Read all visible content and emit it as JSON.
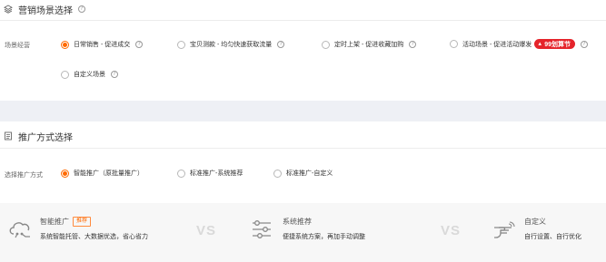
{
  "marketing_scene": {
    "title": "营销场景选择",
    "row_label": "场景经营",
    "options": [
      {
        "label": "日常销售 - 促进成交",
        "checked": true
      },
      {
        "label": "宝贝测款 - 均匀快速获取流量",
        "checked": false
      },
      {
        "label": "定时上架 - 促进收藏加购",
        "checked": false
      },
      {
        "label": "活动场景 - 促进活动爆发",
        "checked": false,
        "badge": "99划算节"
      },
      {
        "label": "自定义场景",
        "checked": false
      }
    ]
  },
  "promotion_method": {
    "title": "推广方式选择",
    "row_label": "选择推广方式",
    "options": [
      {
        "label": "智能推广（原批量推广）",
        "checked": true
      },
      {
        "label": "标准推广-系统推荐",
        "checked": false
      },
      {
        "label": "标准推广-自定义",
        "checked": false
      }
    ]
  },
  "comparison": {
    "vs_text": "VS",
    "items": [
      {
        "title": "智能推广",
        "tag": "推荐",
        "desc": "系统智能托管、大数据优选，省心省力",
        "icon": "cloud-smart-icon"
      },
      {
        "title": "系统推荐",
        "desc": "便捷系统方案，再加手动调整",
        "icon": "sliders-icon"
      },
      {
        "title": "自定义",
        "desc": "自行设置、自行优化",
        "icon": "hand-point-icon"
      }
    ]
  },
  "colors": {
    "accent": "#ff6a00",
    "badge": "#e5242b",
    "panel_bg": "#f7f7f7",
    "gap_bg": "#eef0f5"
  }
}
